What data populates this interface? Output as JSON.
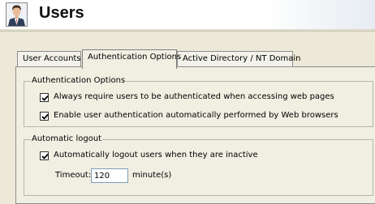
{
  "header": {
    "title": "Users",
    "icon": "user-avatar-icon"
  },
  "tabs": [
    {
      "label": "User Accounts",
      "active": false
    },
    {
      "label": "Authentication Options",
      "active": true
    },
    {
      "label": "Active Directory / NT Domain",
      "active": false
    }
  ],
  "auth_options": {
    "legend": "Authentication Options",
    "require_auth": {
      "label": "Always require users to be authenticated when accessing web pages",
      "checked": true
    },
    "browser_auth": {
      "label": "Enable user authentication automatically performed by Web browsers",
      "checked": true
    }
  },
  "auto_logout": {
    "legend": "Automatic logout",
    "auto_logout": {
      "label": "Automatically logout users when they are inactive",
      "checked": true
    },
    "timeout_label": "Timeout:",
    "timeout_value": "120",
    "unit": "minute(s)"
  }
}
